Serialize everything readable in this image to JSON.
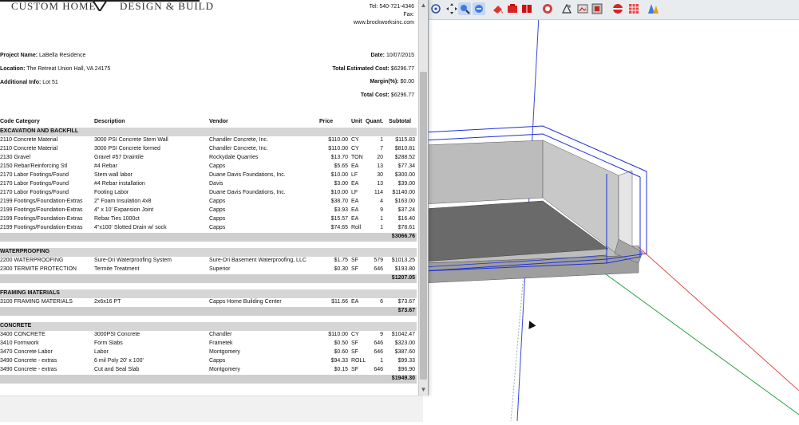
{
  "doc": {
    "logo": {
      "left": "CUSTOM HOME",
      "right": "DESIGN & BUILD"
    },
    "contact": [
      "Tel: 540-721-4346",
      "Fax:",
      "www.brockworksinc.com"
    ],
    "project_name": {
      "label": "Project Name:",
      "value": "LaBella Residence"
    },
    "location": {
      "label": "Location:",
      "value": "The Retreat Union Hall, VA 24175"
    },
    "additional": {
      "label": "Additional Info:",
      "value": "Lot 51"
    },
    "date": {
      "label": "Date:",
      "value": "10/07/2015"
    },
    "total_est": {
      "label": "Total Estimated Cost:",
      "value": "$6296.77"
    },
    "margin": {
      "label": "Margin(%):",
      "value": "$0.00"
    },
    "total_cost": {
      "label": "Total Cost:",
      "value": "$6296.77"
    },
    "headers": {
      "code": "Code Category",
      "desc": "Description",
      "vendor": "Vendor",
      "price": "Price",
      "unit": "Unit",
      "quant": "Quant.",
      "subtotal": "Subtotal"
    },
    "sections": [
      {
        "title": "EXCAVATION AND BACKFILL",
        "rows": [
          [
            "2110 Concrete Material",
            "3000 PSI Concrete Stem Wall",
            "Chandler Concrete, Inc.",
            "$110.00",
            "CY",
            "1",
            "$115.83"
          ],
          [
            "2110 Concrete Material",
            "3000 PSI Concrete formed",
            "Chandler Concrete, Inc.",
            "$110.00",
            "CY",
            "7",
            "$810.81"
          ],
          [
            "2130 Gravel",
            "Gravel #57 Draintile",
            "Rockydale Quarries",
            "$13.70",
            "TON",
            "20",
            "$288.52"
          ],
          [
            "2150 Rebar/Reinforcing Stl",
            "#4 Rebar",
            "Capps",
            "$5.65",
            "EA",
            "13",
            "$77.34"
          ],
          [
            "2170 Labor Footings/Found",
            "Stem wall labor",
            "Duane Davis Foundations, Inc.",
            "$10.00",
            "LF",
            "30",
            "$300.00"
          ],
          [
            "2170 Labor Footings/Found",
            "#4 Rebar installation",
            "Davis",
            "$3.00",
            "EA",
            "13",
            "$39.00"
          ],
          [
            "2170 Labor Footings/Found",
            "Footing Labor",
            "Duane Davis Foundations, Inc.",
            "$10.00",
            "LF",
            "114",
            "$1140.00"
          ],
          [
            "2199 Footings/Foundation-Extras",
            "2\" Foam Insulation 4x8",
            "Capps",
            "$38.70",
            "EA",
            "4",
            "$163.00"
          ],
          [
            "2199 Footings/Foundation-Extras",
            "4\" x 10' Expansion Joint",
            "Capps",
            "$3.93",
            "EA",
            "9",
            "$37.24"
          ],
          [
            "2199 Footings/Foundation-Extras",
            "Rebar Ties 1000ct",
            "Capps",
            "$15.57",
            "EA",
            "1",
            "$16.40"
          ],
          [
            "2199 Footings/Foundation-Extras",
            "4\"x100' Slotted Drain w/ sock",
            "Capps",
            "$74.65",
            "Roll",
            "1",
            "$78.61"
          ]
        ],
        "subtotal": "$3066.76"
      },
      {
        "title": "WATERPROOFING",
        "rows": [
          [
            "2200 WATERPROOFING",
            "Sure-Dri Waterproofing System",
            "Sure-Dri Basement Waterproofing, LLC",
            "$1.75",
            "SF",
            "579",
            "$1013.25"
          ],
          [
            "2300 TERMITE PROTECTION",
            "Termite Treatment",
            "Superior",
            "$0.30",
            "SF",
            "646",
            "$193.80"
          ]
        ],
        "subtotal": "$1207.05"
      },
      {
        "title": "FRAMING MATERIALS",
        "rows": [
          [
            "3100 FRAMING MATERIALS",
            "2x6x16 PT",
            "Capps Home Building Center",
            "$11.66",
            "EA",
            "6",
            "$73.67"
          ]
        ],
        "subtotal": "$73.67"
      },
      {
        "title": "CONCRETE",
        "rows": [
          [
            "3400 CONCRETE",
            "3000PSI Concrete",
            "Chandler",
            "$110.00",
            "CY",
            "9",
            "$1042.47"
          ],
          [
            "3410 Formwork",
            "Form Slabs",
            "Frametek",
            "$0.50",
            "SF",
            "646",
            "$323.00"
          ],
          [
            "3470 Concrete Labor",
            "Labor",
            "Montgomery",
            "$0.60",
            "SF",
            "646",
            "$387.60"
          ],
          [
            "3490 Concrete - extras",
            "6 mil Poly 20' x 100'",
            "Capps",
            "$94.33",
            "ROLL",
            "1",
            "$99.33"
          ],
          [
            "3490 Concrete - extras",
            "Cut and Seal Slab",
            "Montgomery",
            "$0.15",
            "SF",
            "646",
            "$96.90"
          ]
        ],
        "subtotal": "$1949.30"
      }
    ]
  },
  "toolbar": {
    "icons": [
      "orbit-icon",
      "pan-icon",
      "zoom-icon",
      "section-plane-icon",
      "paint-bucket-icon",
      "camera-icon",
      "walk-icon",
      "xray-icon",
      "shaded-icon",
      "textured-icon",
      "monochrome-icon",
      "shadow-icon"
    ]
  }
}
